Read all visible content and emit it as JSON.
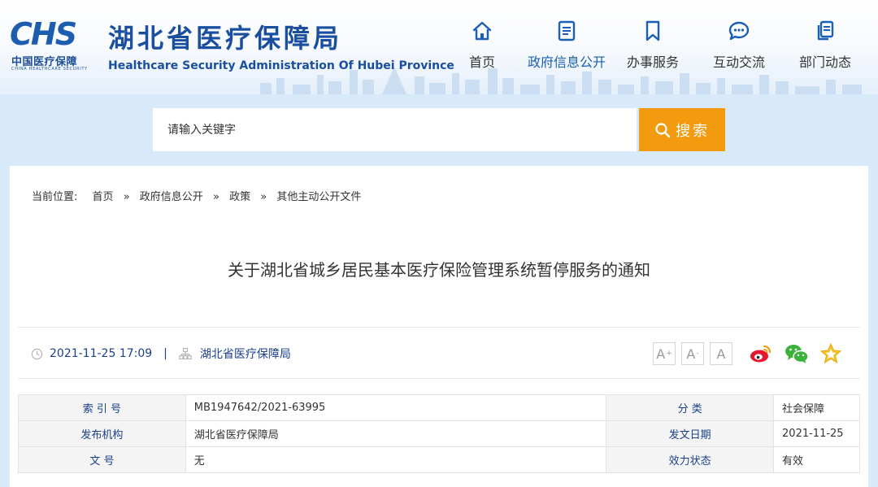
{
  "header": {
    "logo_text": "CHS",
    "logo_cn": "中国医疗保障",
    "logo_en": "CHINA HEALTHCARE SECURITY",
    "site_title_cn": "湖北省医疗保障局",
    "site_title_en": "Healthcare Security Administration Of Hubei Province",
    "brand_color": "#1a4fa0"
  },
  "nav": {
    "items": [
      {
        "label": "首页",
        "icon": "home-icon"
      },
      {
        "label": "政府信息公开",
        "icon": "document-icon",
        "active": true
      },
      {
        "label": "办事服务",
        "icon": "bookmark-icon"
      },
      {
        "label": "互动交流",
        "icon": "chat-icon"
      },
      {
        "label": "部门动态",
        "icon": "copy-icon"
      }
    ],
    "active_color": "#1a5fb4"
  },
  "search": {
    "placeholder": "请输入关键字",
    "button_label": "搜索",
    "button_color": "#f39a0f"
  },
  "breadcrumb": {
    "lead": "当前位置:",
    "items": [
      "首页",
      "政府信息公开",
      "政策",
      "其他主动公开文件"
    ],
    "separator": "»"
  },
  "article": {
    "title": "关于湖北省城乡居民基本医疗保险管理系统暂停服务的通知",
    "datetime": "2021-11-25 17:09",
    "divider": "|",
    "source": "湖北省医疗保障局",
    "font_controls": [
      "A+",
      "A-",
      "A"
    ],
    "share_icons": [
      "weibo-icon",
      "wechat-icon",
      "star-icon"
    ]
  },
  "info_table": {
    "rows": [
      {
        "label1": "索 引 号",
        "value1": "MB1947642/2021-63995",
        "label2": "分 类",
        "value2": "社会保障"
      },
      {
        "label1": "发布机构",
        "value1": "湖北省医疗保障局",
        "label2": "发文日期",
        "value2": "2021-11-25"
      },
      {
        "label1": "文 号",
        "value1": "无",
        "label2": "效力状态",
        "value2": "有效"
      }
    ]
  }
}
